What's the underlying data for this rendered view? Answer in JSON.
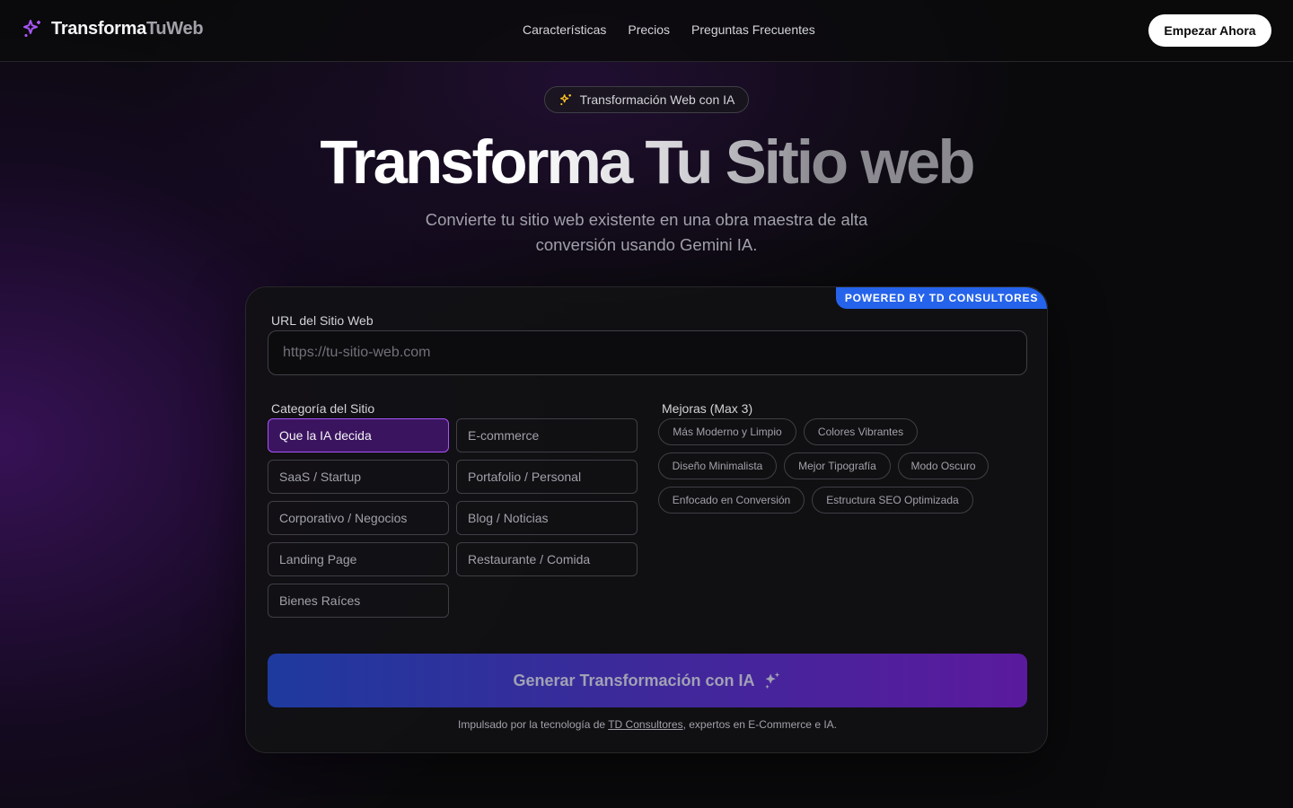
{
  "brand": {
    "name_part1": "Transforma",
    "name_part2": "TuWeb"
  },
  "nav": {
    "items": [
      "Características",
      "Precios",
      "Preguntas Frecuentes"
    ]
  },
  "header": {
    "cta_label": "Empezar Ahora"
  },
  "hero": {
    "badge": "Transformación Web con IA",
    "title": "Transforma Tu Sitio web",
    "subtitle": "Convierte tu sitio web existente en una obra maestra de alta conversión usando Gemini IA."
  },
  "form": {
    "powered_badge": "POWERED BY TD CONSULTORES",
    "url_label": "URL del Sitio Web",
    "url_placeholder": "https://tu-sitio-web.com",
    "url_value": "",
    "category_label": "Categoría del Sitio",
    "categories": [
      "Que la IA decida",
      "E-commerce",
      "SaaS / Startup",
      "Portafolio / Personal",
      "Corporativo / Negocios",
      "Blog / Noticias",
      "Landing Page",
      "Restaurante / Comida",
      "Bienes Raíces"
    ],
    "selected_category": "Que la IA decida",
    "improvements_label": "Mejoras (Max 3)",
    "improvements": [
      "Más Moderno y Limpio",
      "Colores Vibrantes",
      "Diseño Minimalista",
      "Mejor Tipografía",
      "Modo Oscuro",
      "Enfocado en Conversión",
      "Estructura SEO Optimizada"
    ],
    "generate_label": "Generar Transformación con IA",
    "footer_prefix": "Impulsado por la tecnología de ",
    "footer_link": "TD Consultores",
    "footer_suffix": ", expertos en E-Commerce e IA."
  },
  "colors": {
    "accent_purple": "#a855f7",
    "badge_blue": "#2563eb",
    "sparkle_yellow": "#fbbf24"
  }
}
